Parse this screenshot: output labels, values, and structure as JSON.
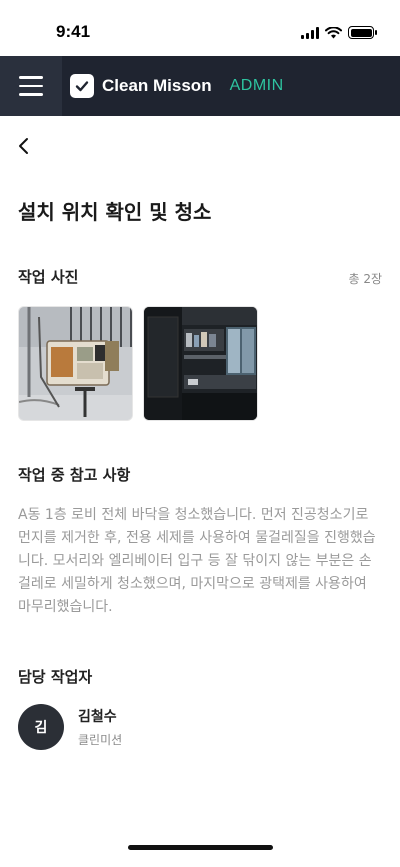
{
  "status_bar": {
    "time": "9:41",
    "battery_level": 1.0
  },
  "app_bar": {
    "title": "Clean Misson",
    "role": "ADMIN",
    "accent_color": "#2ec4a0",
    "background": "#1f2430"
  },
  "page": {
    "title": "설치 위치 확인 및 청소"
  },
  "photos_section": {
    "title": "작업 사진",
    "count": "총 2장",
    "photos": [
      {
        "icon": "electrical-panel-photo"
      },
      {
        "icon": "room-interior-photo"
      }
    ]
  },
  "notes_section": {
    "title": "작업 중 참고 사항",
    "text": "A동 1층 로비 전체 바닥을 청소했습니다. 먼저 진공청소기로 먼지를 제거한 후, 전용 세제를 사용하여 물걸레질을 진행했습니다. 모서리와 엘리베이터 입구 등 잘 닦이지 않는 부분은 손걸레로 세밀하게 청소했으며, 마지막으로 광택제를 사용하여 마무리했습니다."
  },
  "worker_section": {
    "title": "담당 작업자",
    "avatar_initial": "김",
    "name": "김철수",
    "organization": "클린미션"
  }
}
